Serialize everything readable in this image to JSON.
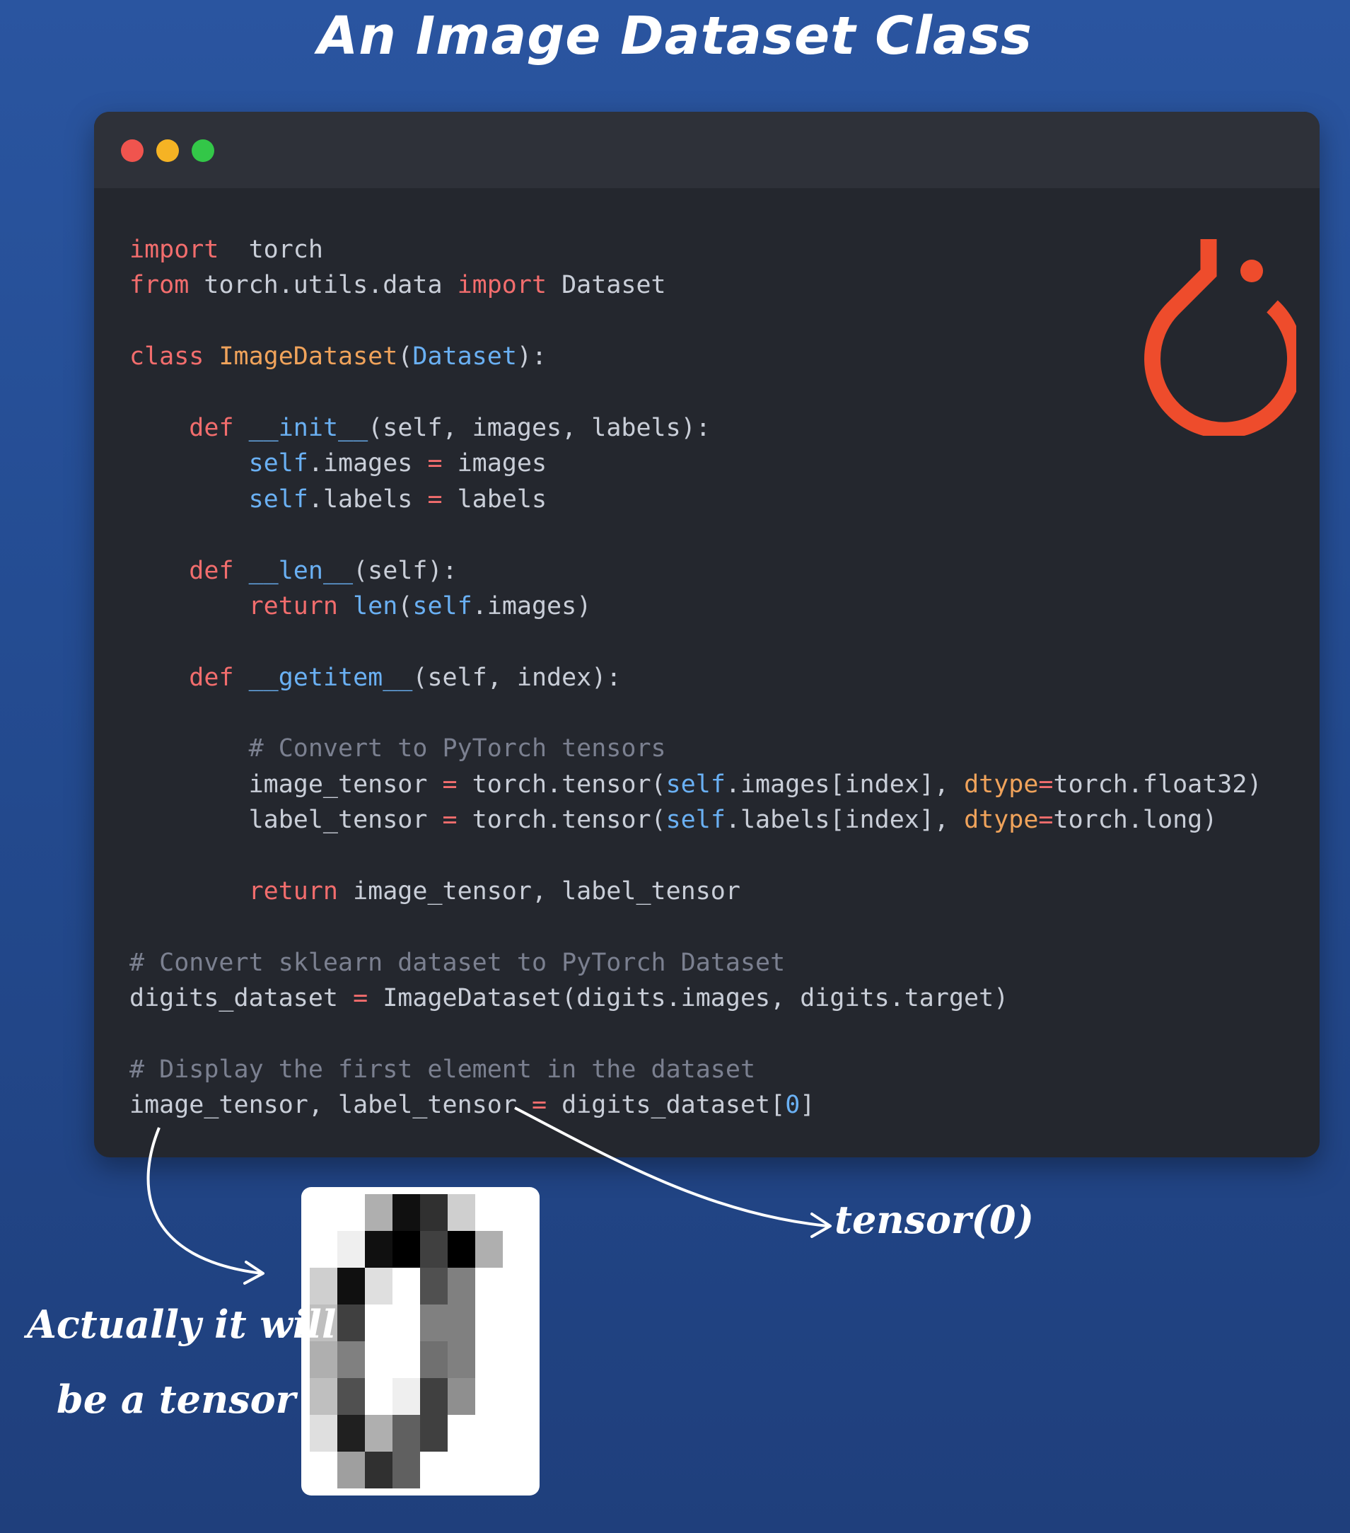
{
  "title": "An Image Dataset Class",
  "window": {
    "buttons": [
      {
        "name": "close",
        "color": "#f0544e"
      },
      {
        "name": "minimize",
        "color": "#f5b324"
      },
      {
        "name": "maximize",
        "color": "#33c748"
      }
    ]
  },
  "logo": {
    "name": "pytorch-logo",
    "color": "#ee4c2c"
  },
  "code": [
    [
      [
        "kw",
        "import"
      ],
      [
        "",
        "  torch"
      ]
    ],
    [
      [
        "kw",
        "from"
      ],
      [
        "",
        " torch.utils.data "
      ],
      [
        "kw",
        "import"
      ],
      [
        "",
        " Dataset"
      ]
    ],
    [],
    [
      [
        "kw",
        "class"
      ],
      [
        "",
        " "
      ],
      [
        "cls",
        "ImageDataset"
      ],
      [
        "",
        "("
      ],
      [
        "bi",
        "Dataset"
      ],
      [
        "",
        "):"
      ]
    ],
    [],
    [
      [
        "",
        "    "
      ],
      [
        "kw",
        "def"
      ],
      [
        "",
        " "
      ],
      [
        "bi",
        "__init__"
      ],
      [
        "",
        "(self, images, labels):"
      ]
    ],
    [
      [
        "",
        "        "
      ],
      [
        "bi",
        "self"
      ],
      [
        "",
        ".images "
      ],
      [
        "kw",
        "="
      ],
      [
        "",
        " images"
      ]
    ],
    [
      [
        "",
        "        "
      ],
      [
        "bi",
        "self"
      ],
      [
        "",
        ".labels "
      ],
      [
        "kw",
        "="
      ],
      [
        "",
        " labels"
      ]
    ],
    [],
    [
      [
        "",
        "    "
      ],
      [
        "kw",
        "def"
      ],
      [
        "",
        " "
      ],
      [
        "bi",
        "__len__"
      ],
      [
        "",
        "(self):"
      ]
    ],
    [
      [
        "",
        "        "
      ],
      [
        "kw",
        "return"
      ],
      [
        "",
        " "
      ],
      [
        "bi",
        "len"
      ],
      [
        "",
        "("
      ],
      [
        "bi",
        "self"
      ],
      [
        "",
        ".images)"
      ]
    ],
    [],
    [
      [
        "",
        "    "
      ],
      [
        "kw",
        "def"
      ],
      [
        "",
        " "
      ],
      [
        "bi",
        "__getitem__"
      ],
      [
        "",
        "(self, index):"
      ]
    ],
    [],
    [
      [
        "",
        "        "
      ],
      [
        "cmt",
        "# Convert to PyTorch tensors"
      ]
    ],
    [
      [
        "",
        "        image_tensor "
      ],
      [
        "kw",
        "="
      ],
      [
        "",
        " torch.tensor("
      ],
      [
        "bi",
        "self"
      ],
      [
        "",
        ".images[index], "
      ],
      [
        "param",
        "dtype"
      ],
      [
        "kw",
        "="
      ],
      [
        "",
        "torch.float32)"
      ]
    ],
    [
      [
        "",
        "        label_tensor "
      ],
      [
        "kw",
        "="
      ],
      [
        "",
        " torch.tensor("
      ],
      [
        "bi",
        "self"
      ],
      [
        "",
        ".labels[index], "
      ],
      [
        "param",
        "dtype"
      ],
      [
        "kw",
        "="
      ],
      [
        "",
        "torch.long)"
      ]
    ],
    [],
    [
      [
        "",
        "        "
      ],
      [
        "kw",
        "return"
      ],
      [
        "",
        " image_tensor, label_tensor"
      ]
    ],
    [],
    [
      [
        "cmt",
        "# Convert sklearn dataset to PyTorch Dataset"
      ]
    ],
    [
      [
        "",
        "digits_dataset "
      ],
      [
        "kw",
        "="
      ],
      [
        "",
        " ImageDataset(digits.images, digits.target)"
      ]
    ],
    [],
    [
      [
        "cmt",
        "# Display the first element in the dataset"
      ]
    ],
    [
      [
        "",
        "image_tensor, label_tensor "
      ],
      [
        "kw",
        "="
      ],
      [
        "",
        " digits_dataset["
      ],
      [
        "num",
        "0"
      ],
      [
        "",
        "]"
      ]
    ]
  ],
  "annotations": {
    "tensor_output": "tensor(0)",
    "note_line1": "Actually it will",
    "note_line2": "be a tensor"
  },
  "digit_image": {
    "name": "digit-zero-image",
    "grid": [
      [
        0,
        0,
        5,
        15,
        13,
        3,
        0,
        0
      ],
      [
        0,
        1,
        15,
        16,
        12,
        16,
        5,
        0
      ],
      [
        3,
        15,
        2,
        0,
        11,
        8,
        0,
        0
      ],
      [
        4,
        12,
        0,
        0,
        8,
        8,
        0,
        0
      ],
      [
        5,
        8,
        0,
        0,
        9,
        8,
        0,
        0
      ],
      [
        4,
        11,
        0,
        1,
        12,
        7,
        0,
        0
      ],
      [
        2,
        14,
        5,
        10,
        12,
        0,
        0,
        0
      ],
      [
        0,
        6,
        13,
        10,
        0,
        0,
        0,
        0
      ]
    ]
  }
}
